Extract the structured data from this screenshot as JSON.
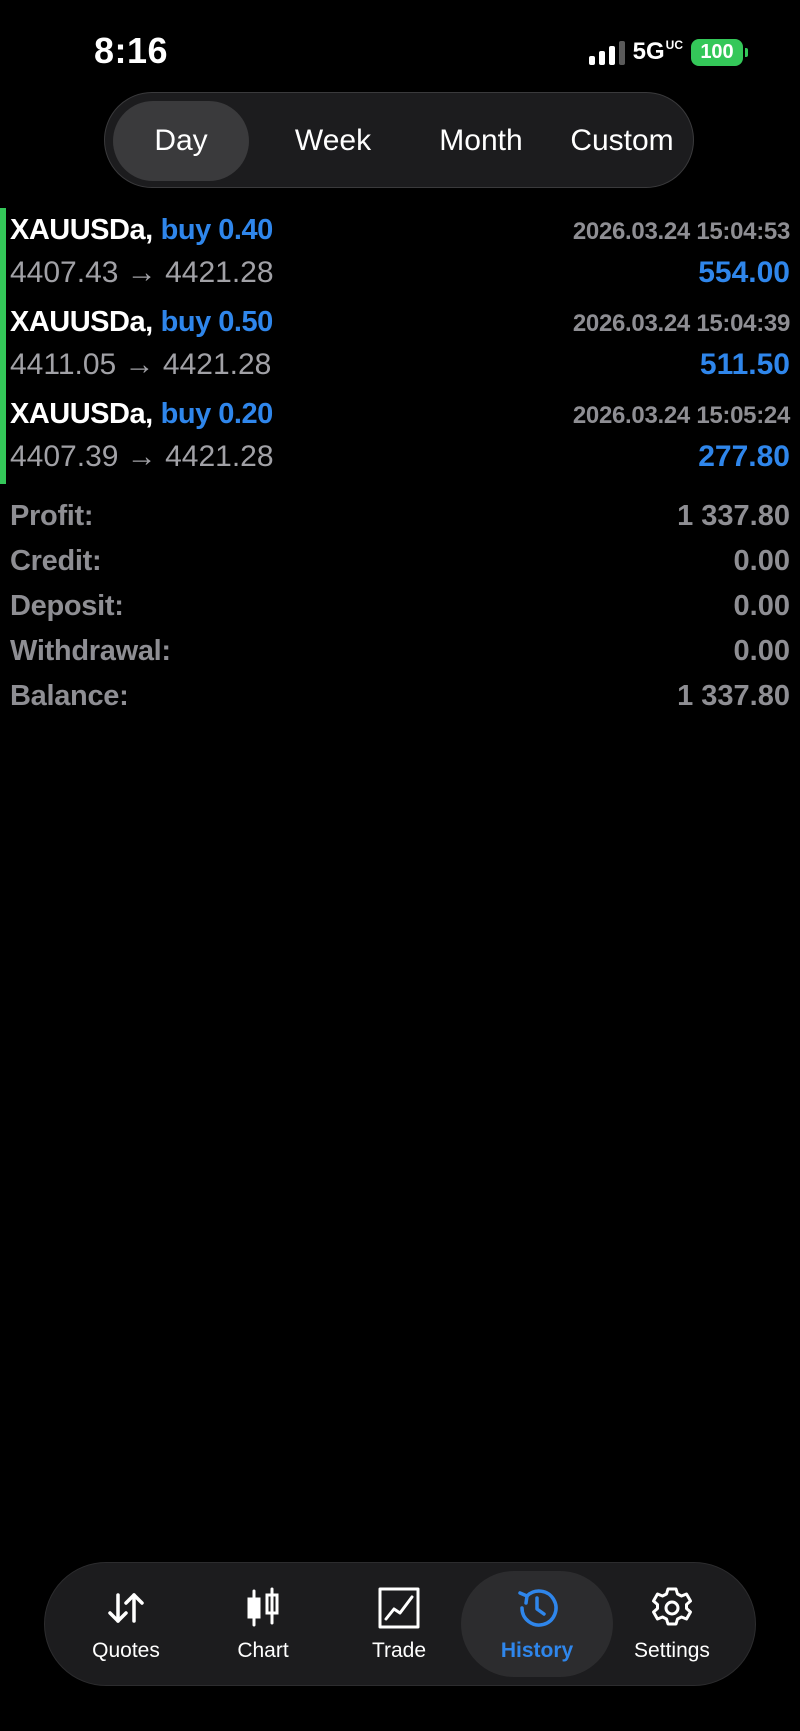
{
  "status_bar": {
    "time": "8:16",
    "network": "5G",
    "network_suffix": "UC",
    "battery": "100"
  },
  "period_tabs": {
    "items": [
      {
        "label": "Day",
        "selected": true
      },
      {
        "label": "Week",
        "selected": false
      },
      {
        "label": "Month",
        "selected": false
      },
      {
        "label": "Custom",
        "selected": false
      }
    ]
  },
  "trades": [
    {
      "symbol": "XAUUSDa,",
      "side": "buy 0.40",
      "time": "2026.03.24 15:04:53",
      "prices": "4407.43 → 4421.28",
      "profit": "554.00"
    },
    {
      "symbol": "XAUUSDa,",
      "side": "buy 0.50",
      "time": "2026.03.24 15:04:39",
      "prices": "4411.05 → 4421.28",
      "profit": "511.50"
    },
    {
      "symbol": "XAUUSDa,",
      "side": "buy 0.20",
      "time": "2026.03.24 15:05:24",
      "prices": "4407.39 → 4421.28",
      "profit": "277.80"
    }
  ],
  "summary": [
    {
      "label": "Profit:",
      "value": "1 337.80"
    },
    {
      "label": "Credit:",
      "value": "0.00"
    },
    {
      "label": "Deposit:",
      "value": "0.00"
    },
    {
      "label": "Withdrawal:",
      "value": "0.00"
    },
    {
      "label": "Balance:",
      "value": "1 337.80"
    }
  ],
  "tabbar": {
    "items": [
      {
        "label": "Quotes",
        "icon": "quotes-icon",
        "active": false
      },
      {
        "label": "Chart",
        "icon": "candlestick-chart-icon",
        "active": false
      },
      {
        "label": "Trade",
        "icon": "trade-chart-icon",
        "active": false
      },
      {
        "label": "History",
        "icon": "history-clock-icon",
        "active": true
      },
      {
        "label": "Settings",
        "icon": "gear-icon",
        "active": false
      }
    ]
  },
  "colors": {
    "accent": "#2f86eb",
    "buy_bar": "#34c759",
    "background": "#000000",
    "muted_text": "#8e8e93"
  }
}
